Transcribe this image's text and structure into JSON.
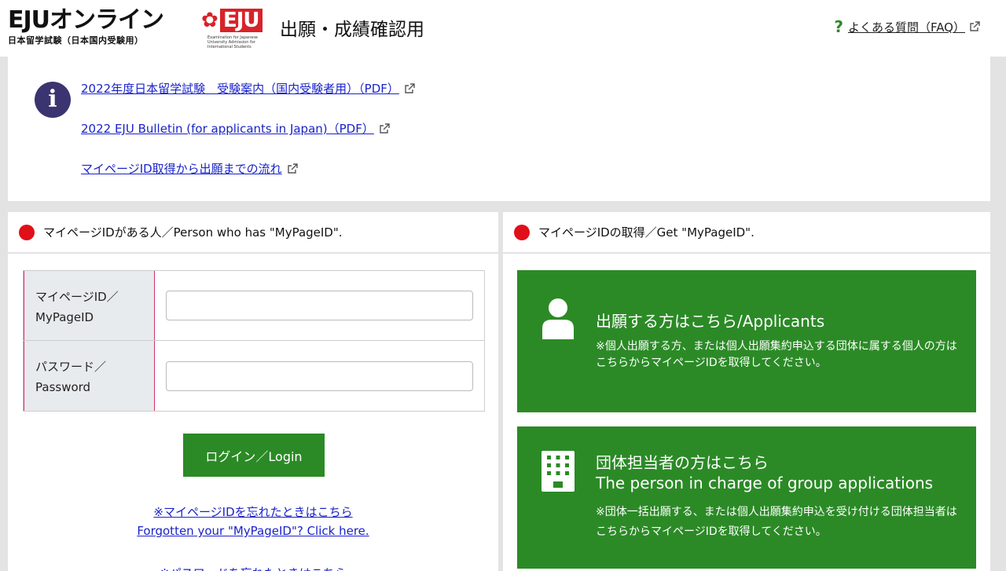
{
  "header": {
    "logo_main": "EJUオンライン",
    "logo_badge": "EJU",
    "logo_sub": "日本留学試験（日本国内受験用）",
    "logo_en": "Examination for Japanese University Admission for International Students",
    "site_title": "出願・成績確認用",
    "faq_label": "よくある質問（FAQ）"
  },
  "info": {
    "links": [
      "2022年度日本留学試験　受験案内（国内受験者用）（PDF）",
      "2022 EJU Bulletin (for applicants in Japan)（PDF）",
      "マイページID取得から出願までの流れ"
    ]
  },
  "login_panel": {
    "heading": "マイページIDがある人／Person who has \"MyPageID\".",
    "id_label_1": "マイページID／",
    "id_label_2": "MyPageID",
    "pw_label_1": "パスワード／",
    "pw_label_2": "Password",
    "id_value": "",
    "pw_value": "",
    "login_button": "ログイン／Login",
    "forgot_id_jp": "※マイページIDを忘れたときはこちら",
    "forgot_id_en": "Forgotten your \"MyPageID\"? Click here.",
    "forgot_pw_jp": "※パスワードを忘れたときはこちら"
  },
  "register_panel": {
    "heading": "マイページIDの取得／Get \"MyPageID\".",
    "applicants_title": "出願する方はこちら/Applicants",
    "applicants_note": "※個人出願する方、または個人出願集約申込する団体に属する個人の方はこちらからマイページIDを取得してください。",
    "group_title_1": "団体担当者の方はこちら",
    "group_title_2": "The person in charge of group applications",
    "group_note": "※団体一括出願する、または個人出願集約申込を受け付ける団体担当者はこちらからマイページIDを取得してください。"
  },
  "colors": {
    "accent_green": "#2b8a26",
    "dot_red": "#e0101a",
    "link_blue": "#1a23c8",
    "info_icon": "#3a3470"
  },
  "icons": [
    "info-icon",
    "external-link-icon",
    "question-icon",
    "person-icon",
    "building-icon"
  ]
}
